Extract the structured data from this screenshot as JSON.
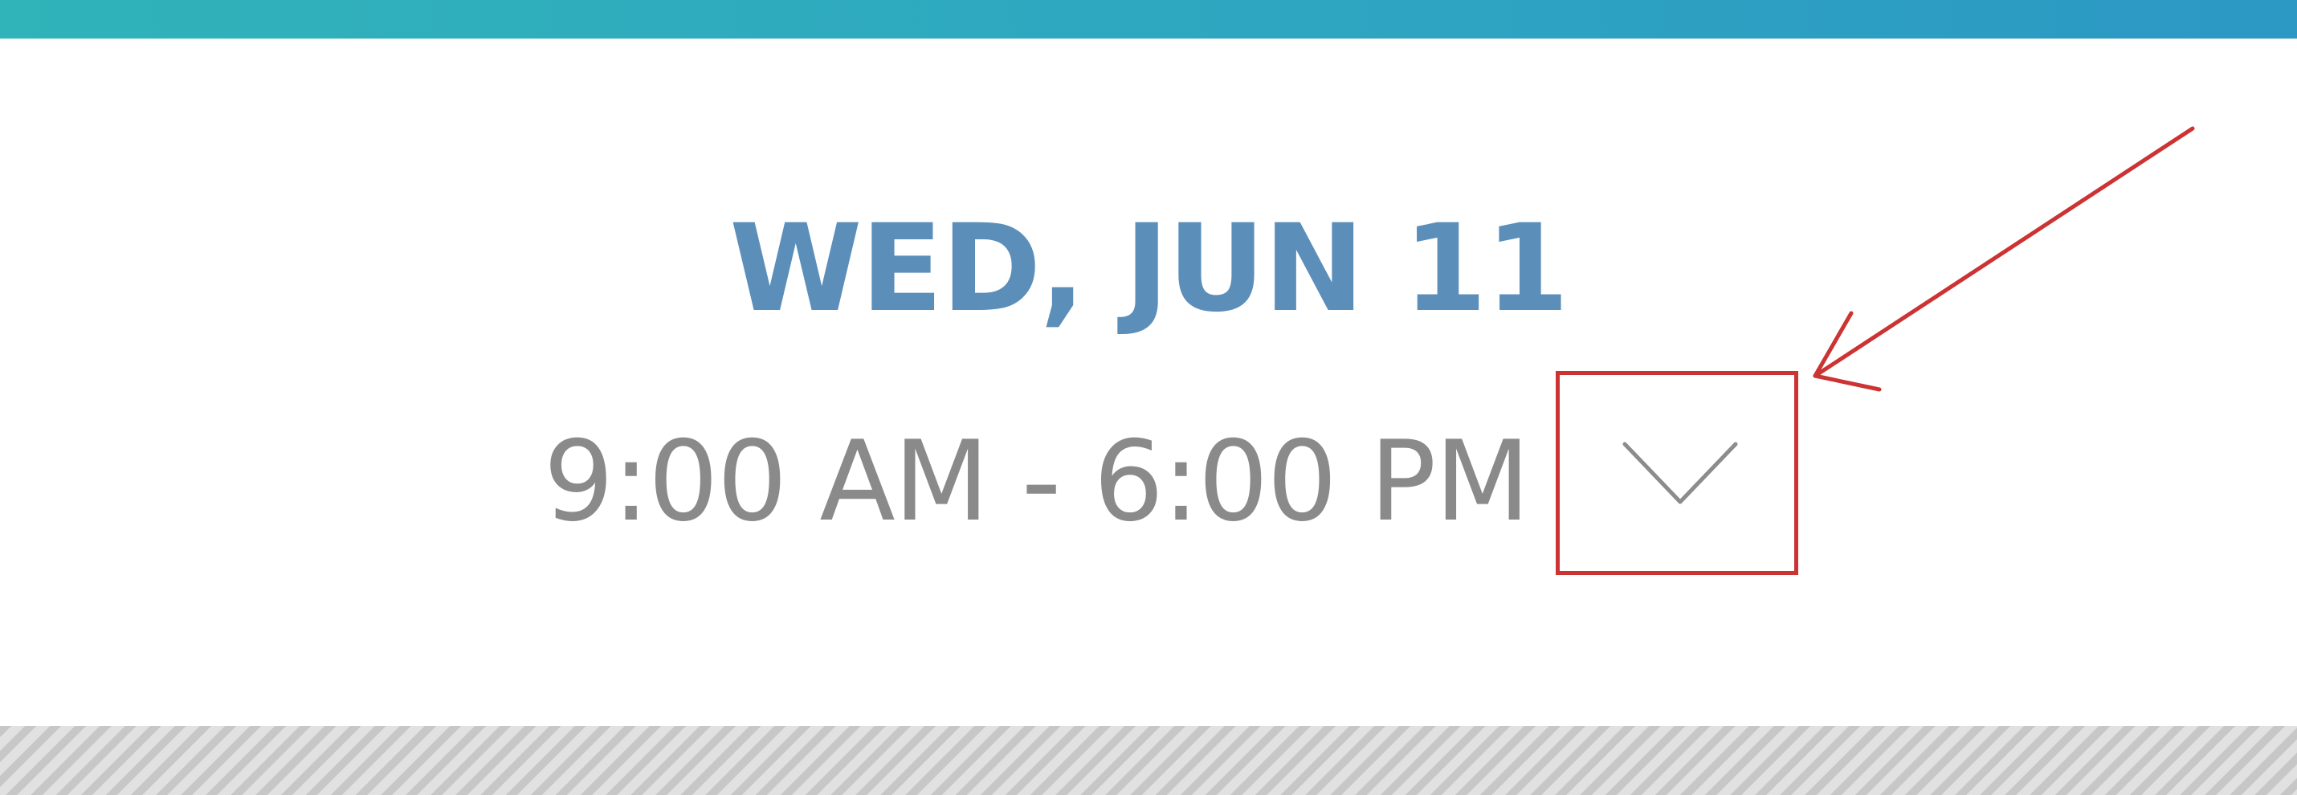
{
  "header": {
    "bar_color": "#2ea6c1"
  },
  "schedule": {
    "date": "WED, JUN 11",
    "time_range": "9:00 AM - 6:00 PM",
    "dropdown_icon": "chevron-down-icon"
  },
  "annotation": {
    "color": "#cc3333",
    "target": "dropdown-toggle"
  },
  "colors": {
    "date_text": "#5b8fba",
    "time_text": "#8a8a8a",
    "hatch": "#d0d0d0"
  }
}
